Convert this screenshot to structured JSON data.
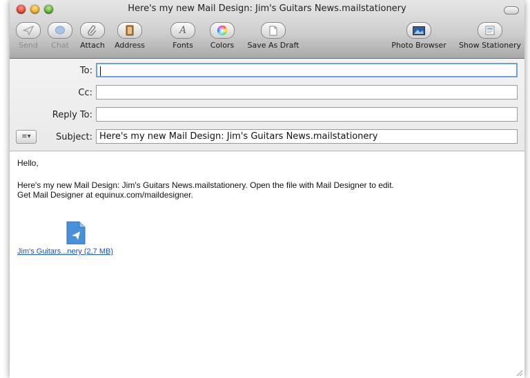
{
  "window": {
    "title": "Here's my new Mail Design: Jim's Guitars News.mailstationery"
  },
  "toolbar": {
    "send": "Send",
    "chat": "Chat",
    "attach": "Attach",
    "address": "Address",
    "fonts": "Fonts",
    "colors": "Colors",
    "save_draft": "Save As Draft",
    "photo_browser": "Photo Browser",
    "show_stationery": "Show Stationery"
  },
  "headers": {
    "to_label": "To:",
    "to_value": "",
    "cc_label": "Cc:",
    "cc_value": "",
    "reply_label": "Reply To:",
    "reply_value": "",
    "subject_label": "Subject:",
    "subject_value": "Here's my new Mail Design: Jim's Guitars News.mailstationery",
    "account_menu": "≡▾"
  },
  "message": {
    "greeting": "Hello,",
    "line1": "Here's my new Mail Design: Jim's Guitars News.mailstationery. Open the file with Mail Designer to edit.",
    "line2": "Get Mail Designer at equinux.com/maildesigner.",
    "attachment_label": "Jim's Guitars...nery (2,7 MB)"
  },
  "colors": {
    "link": "#1a4fc8",
    "focus_ring": "#6ea0dc",
    "attachment_icon": "#4a90d9"
  }
}
